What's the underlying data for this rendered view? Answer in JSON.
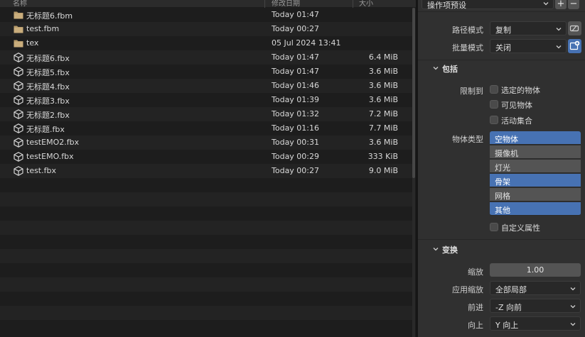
{
  "file_browser": {
    "columns": {
      "name": "名称",
      "date": "修改日期",
      "size": "大小"
    },
    "files": [
      {
        "icon": "folder-icon",
        "name": "无标题6.fbm",
        "date": "Today 01:47",
        "size": ""
      },
      {
        "icon": "folder-icon",
        "name": "test.fbm",
        "date": "Today 00:27",
        "size": ""
      },
      {
        "icon": "folder-icon",
        "name": "tex",
        "date": "05 Jul 2024 13:41",
        "size": ""
      },
      {
        "icon": "cube-icon",
        "name": "无标题6.fbx",
        "date": "Today 01:47",
        "size": "6.4 MiB"
      },
      {
        "icon": "cube-icon",
        "name": "无标题5.fbx",
        "date": "Today 01:47",
        "size": "3.6 MiB"
      },
      {
        "icon": "cube-icon",
        "name": "无标题4.fbx",
        "date": "Today 01:46",
        "size": "3.6 MiB"
      },
      {
        "icon": "cube-icon",
        "name": "无标题3.fbx",
        "date": "Today 01:39",
        "size": "3.6 MiB"
      },
      {
        "icon": "cube-icon",
        "name": "无标题2.fbx",
        "date": "Today 01:32",
        "size": "7.2 MiB"
      },
      {
        "icon": "cube-icon",
        "name": "无标题.fbx",
        "date": "Today 01:16",
        "size": "7.7 MiB"
      },
      {
        "icon": "cube-icon",
        "name": "testEMO2.fbx",
        "date": "Today 00:31",
        "size": "3.6 MiB"
      },
      {
        "icon": "cube-icon",
        "name": "testEMO.fbx",
        "date": "Today 00:29",
        "size": "333 KiB"
      },
      {
        "icon": "cube-icon",
        "name": "test.fbx",
        "date": "Today 00:27",
        "size": "9.0 MiB"
      }
    ]
  },
  "settings": {
    "preset": {
      "value": "操作项预设",
      "add": "+",
      "remove": "−"
    },
    "path_mode": {
      "label": "路径模式",
      "value": "复制"
    },
    "batch_mode": {
      "label": "批量模式",
      "value": "关闭"
    },
    "include": {
      "title": "包括",
      "limit_label": "限制到",
      "limit_options": [
        "选定的物体",
        "可见物体",
        "活动集合"
      ],
      "object_type_label": "物体类型",
      "object_types": [
        {
          "label": "空物体",
          "active": true
        },
        {
          "label": "摄像机",
          "active": false
        },
        {
          "label": "灯光",
          "active": false
        },
        {
          "label": "骨架",
          "active": true
        },
        {
          "label": "网格",
          "active": false
        },
        {
          "label": "其他",
          "active": true
        }
      ],
      "custom_props": "自定义属性"
    },
    "transform": {
      "title": "变换",
      "scale_label": "缩放",
      "scale_value": "1.00",
      "apply_scale_label": "应用缩放",
      "apply_scale_value": "全部局部",
      "forward_label": "前进",
      "forward_value": "-Z 向前",
      "up_label": "向上",
      "up_value": "Y 向上"
    }
  },
  "colors": {
    "accent_blue": "#4772b3",
    "folder": "#b79b6b",
    "panel_bg": "#303030",
    "list_bg": "#1d1d1d"
  }
}
